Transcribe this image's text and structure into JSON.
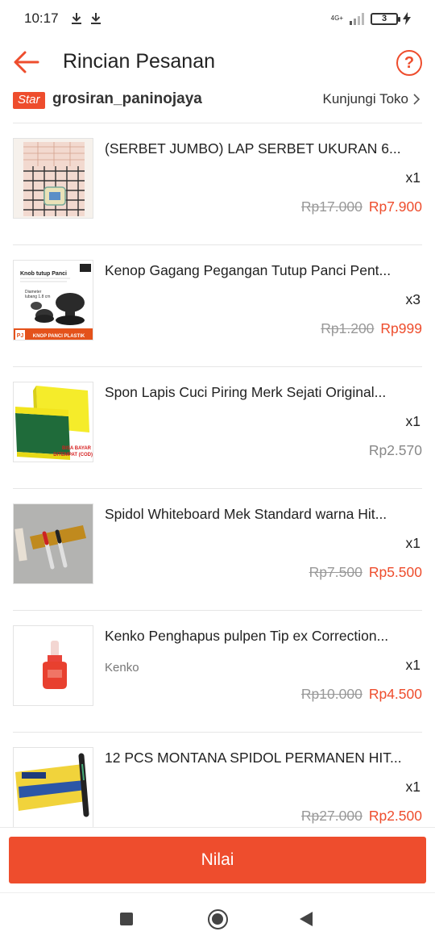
{
  "status_bar": {
    "time": "10:17",
    "network": "4G+",
    "battery": "3"
  },
  "header": {
    "title": "Rincian Pesanan",
    "back_icon": "arrow-left-icon",
    "help_icon": "question-circle-icon",
    "help_symbol": "?"
  },
  "shop": {
    "badge": "Star",
    "name": "grosiran_paninojaya",
    "visit_label": "Kunjungi Toko"
  },
  "products": [
    {
      "name": "(SERBET JUMBO)  LAP SERBET UKURAN 6...",
      "variant": "",
      "qty": "x1",
      "old_price": "Rp17.000",
      "price": "Rp7.900"
    },
    {
      "name": "Kenop Gagang Pegangan Tutup Panci Pent...",
      "variant": "",
      "qty": "x3",
      "old_price": "Rp1.200",
      "price": "Rp999",
      "image_text": {
        "title": "Knob tutup Panci",
        "diameter": "Diameter",
        "diameter_value": "lubang 1.8 cm",
        "banner": "KNOP PANCI PLASTIK",
        "logo": "PJ"
      }
    },
    {
      "name": "Spon Lapis Cuci Piring Merk Sejati Original...",
      "variant": "",
      "qty": "x1",
      "old_price": "",
      "price": "Rp2.570",
      "image_text": {
        "note_line1": "BISA BAYAR",
        "note_line2": "DITEMPAT (COD)"
      }
    },
    {
      "name": "Spidol Whiteboard Mek Standard warna Hit...",
      "variant": "",
      "qty": "x1",
      "old_price": "Rp7.500",
      "price": "Rp5.500"
    },
    {
      "name": "Kenko Penghapus pulpen Tip ex Correction...",
      "variant": "Kenko",
      "qty": "x1",
      "old_price": "Rp10.000",
      "price": "Rp4.500"
    },
    {
      "name": "12 PCS MONTANA SPIDOL PERMANEN HIT...",
      "variant": "",
      "qty": "x1",
      "old_price": "Rp27.000",
      "price": "Rp2.500"
    }
  ],
  "footer": {
    "rate_button": "Nilai"
  },
  "colors": {
    "accent": "#ee4d2d",
    "text": "#222222",
    "muted": "#999999"
  }
}
